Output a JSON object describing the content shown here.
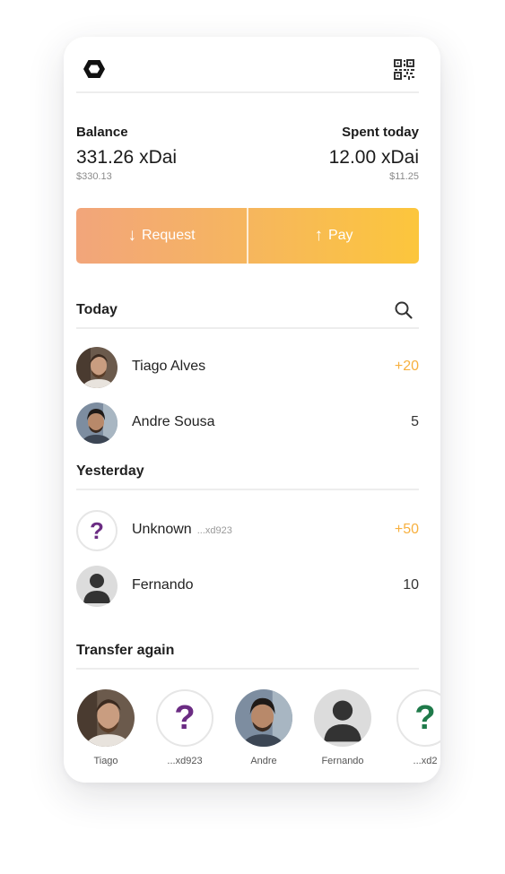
{
  "colors": {
    "accent": "#f7b03f",
    "gradient_start": "#f2a57b",
    "gradient_end": "#fcc63c",
    "unknown_mark_purple": "#6b2c83",
    "unknown_mark_green": "#1f7a4a"
  },
  "icons": {
    "logo": "hexagon-logo-icon",
    "qr": "qr-code-icon",
    "search": "search-icon",
    "request": "arrow-down-icon",
    "pay": "arrow-up-icon"
  },
  "balance": {
    "label": "Balance",
    "amount": "331.26 xDai",
    "usd": "$330.13"
  },
  "spent": {
    "label": "Spent today",
    "amount": "12.00 xDai",
    "usd": "$11.25"
  },
  "actions": {
    "request_label": "Request",
    "pay_label": "Pay"
  },
  "today": {
    "title": "Today",
    "items": [
      {
        "name": "Tiago Alves",
        "value": "+20"
      },
      {
        "name": "Andre Sousa",
        "value": "5"
      }
    ]
  },
  "yesterday": {
    "title": "Yesterday",
    "items": [
      {
        "name": "Unknown",
        "address": "...xd923",
        "value": "+50"
      },
      {
        "name": "Fernando",
        "value": "10"
      }
    ]
  },
  "transfer_again": {
    "title": "Transfer again",
    "items": [
      {
        "label": "Tiago"
      },
      {
        "label": "...xd923"
      },
      {
        "label": "Andre"
      },
      {
        "label": "Fernando"
      },
      {
        "label": "...xd2"
      }
    ]
  }
}
